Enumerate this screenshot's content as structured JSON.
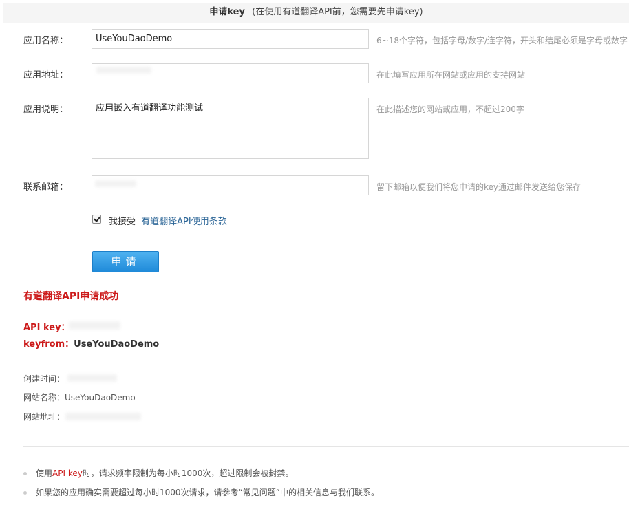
{
  "header": {
    "title": "申请key",
    "subtitle": "(在使用有道翻译API前，您需要先申请key)"
  },
  "form": {
    "app_name": {
      "label": "应用名称：",
      "value": "UseYouDaoDemo",
      "hint": "6~18个字符，包括字母/数字/连字符，开头和结尾必须是字母或数字"
    },
    "app_url": {
      "label": "应用地址：",
      "value": "",
      "hint": "在此填写应用所在网站或应用的支持网站"
    },
    "app_desc": {
      "label": "应用说明：",
      "value": "应用嵌入有道翻译功能测试",
      "hint": "在此描述您的网站或应用，不超过200字"
    },
    "email": {
      "label": "联系邮箱：",
      "value": "",
      "hint": "留下邮箱以便我们将您申请的key通过邮件发送给您保存"
    },
    "agree": {
      "checked": true,
      "text": "我接受",
      "link": "有道翻译API使用条款"
    },
    "submit_label": "申请"
  },
  "result": {
    "success": "有道翻译API申请成功",
    "api_key_label": "API key：",
    "keyfrom_label": "keyfrom：",
    "keyfrom_value": "UseYouDaoDemo",
    "created_label": "创建时间：",
    "site_name_label": "网站名称：",
    "site_name_value": "UseYouDaoDemo",
    "site_url_label": "网站地址："
  },
  "notes": [
    {
      "prefix": "使用",
      "highlight": "API key",
      "suffix": "时，请求频率限制为每小时1000次，超过限制会被封禁。"
    },
    {
      "prefix": "如果您的应用确实需要超过每小时1000次请求，请参考“常见问题”中的相关信息与我们联系。",
      "highlight": "",
      "suffix": ""
    }
  ],
  "colors": {
    "accent_red": "#cc1a1a",
    "button_blue": "#1f8ad9",
    "link_blue": "#2a6496"
  }
}
